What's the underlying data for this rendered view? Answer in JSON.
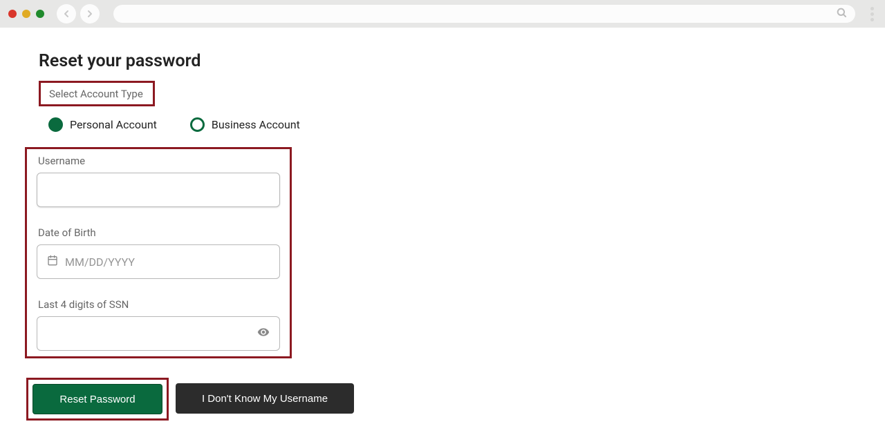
{
  "page": {
    "title": "Reset your password",
    "account_type_label": "Select Account Type"
  },
  "radio": {
    "personal": "Personal Account",
    "business": "Business Account"
  },
  "fields": {
    "username_label": "Username",
    "dob_label": "Date of Birth",
    "dob_placeholder": "MM/DD/YYYY",
    "ssn_label": "Last 4 digits of SSN"
  },
  "buttons": {
    "reset": "Reset Password",
    "unknown_username": "I Don't Know My Username"
  }
}
